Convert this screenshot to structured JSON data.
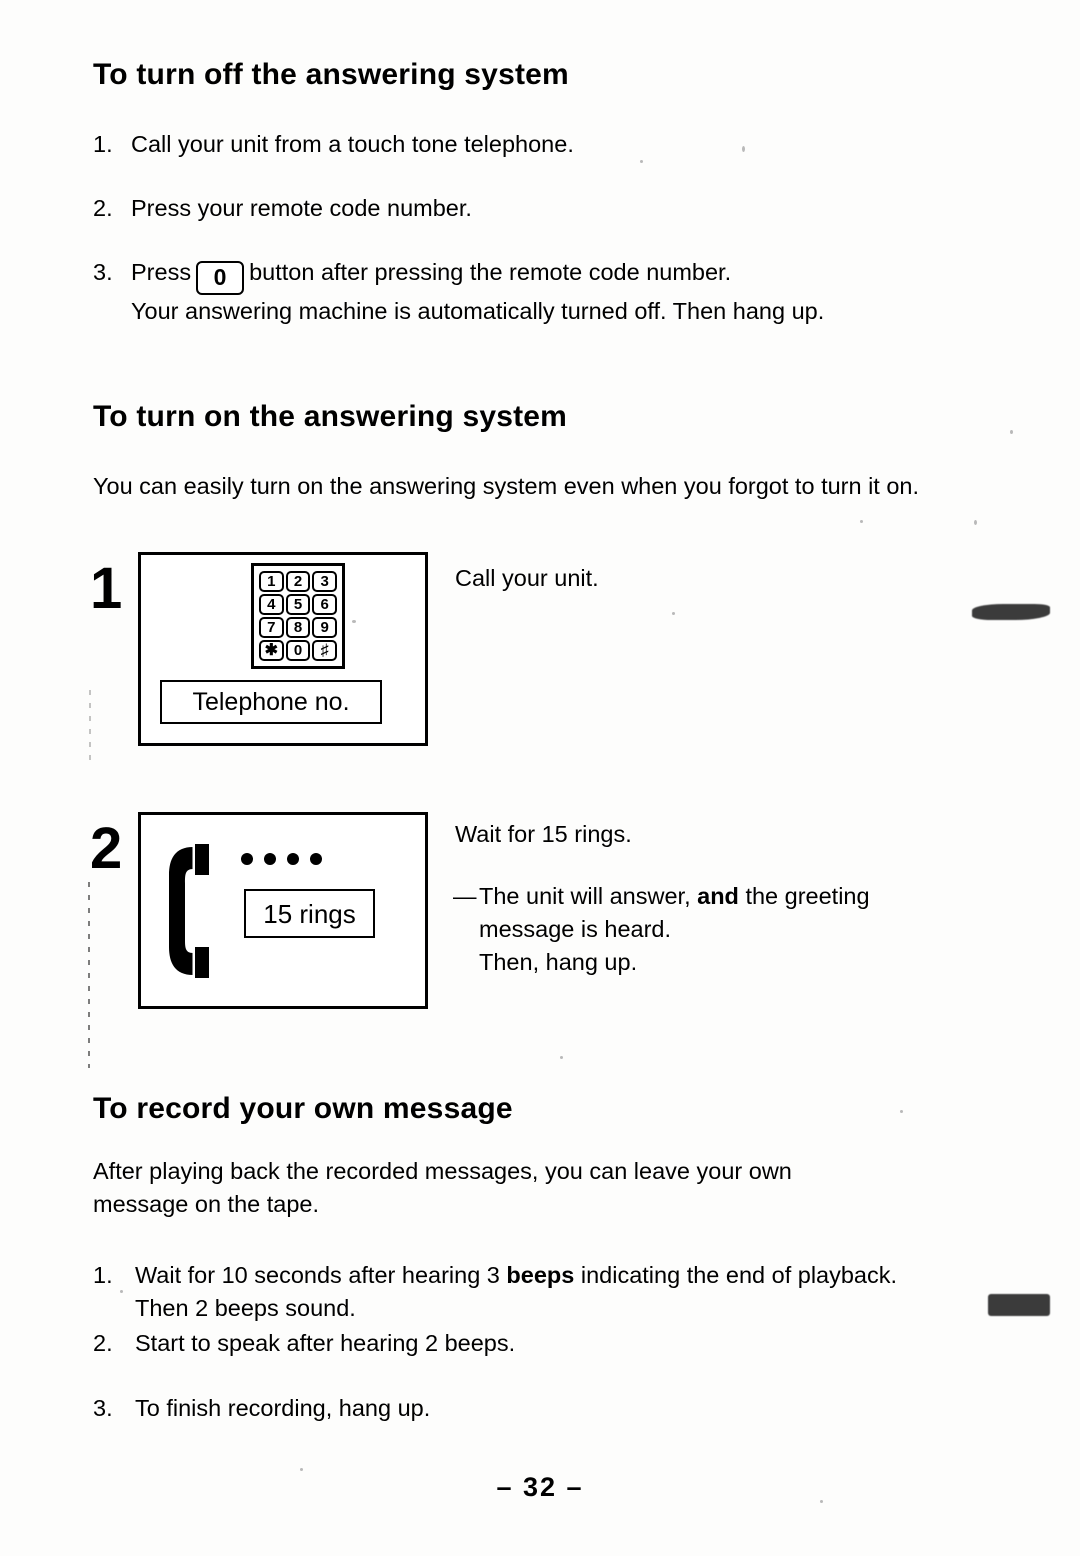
{
  "page": {
    "number_label": "– 32 –"
  },
  "section_off": {
    "heading": "To turn off the answering system",
    "steps": [
      {
        "num": "1.",
        "text": "Call your unit from a touch tone telephone."
      },
      {
        "num": "2.",
        "text": "Press your remote code number."
      },
      {
        "num": "3.",
        "text_before": "Press",
        "key_label": "0",
        "text_after": "button after pressing the remote code number.",
        "text_line2": "Your answering machine is automatically turned off. Then hang up."
      }
    ]
  },
  "section_on": {
    "heading": "To turn on the answering system",
    "intro": "You can easily turn on the answering system even when you forgot to turn it on.",
    "steps": [
      {
        "number": "1",
        "caption": "Call your unit.",
        "illustration": {
          "type": "keypad",
          "keys": [
            "1",
            "2",
            "3",
            "4",
            "5",
            "6",
            "7",
            "8",
            "9",
            "✱",
            "0",
            "♯"
          ],
          "label_box": "Telephone no."
        }
      },
      {
        "number": "2",
        "caption": "Wait for 15 rings.",
        "note": {
          "dash": "—",
          "line1_a": "The unit will answer,",
          "line1_bold": "and",
          "line1_b": "the greeting",
          "line2": "message is heard.",
          "line3": "Then, hang up."
        },
        "illustration": {
          "type": "handset",
          "dots": 4,
          "label_box": "15 rings"
        }
      }
    ]
  },
  "section_record": {
    "heading": "To record your own message",
    "intro_line1": "After playing back the recorded messages, you can leave your own",
    "intro_line2": "message on the tape.",
    "steps": [
      {
        "num": "1.",
        "line1_a": "Wait for 10 seconds after hearing 3",
        "line1_bold": "beeps",
        "line1_b": "indicating the end of playback.",
        "line2": "Then 2 beeps sound."
      },
      {
        "num": "2.",
        "line1": "Start to speak after hearing 2 beeps."
      },
      {
        "num": "3.",
        "line1": "To finish recording, hang up."
      }
    ]
  }
}
